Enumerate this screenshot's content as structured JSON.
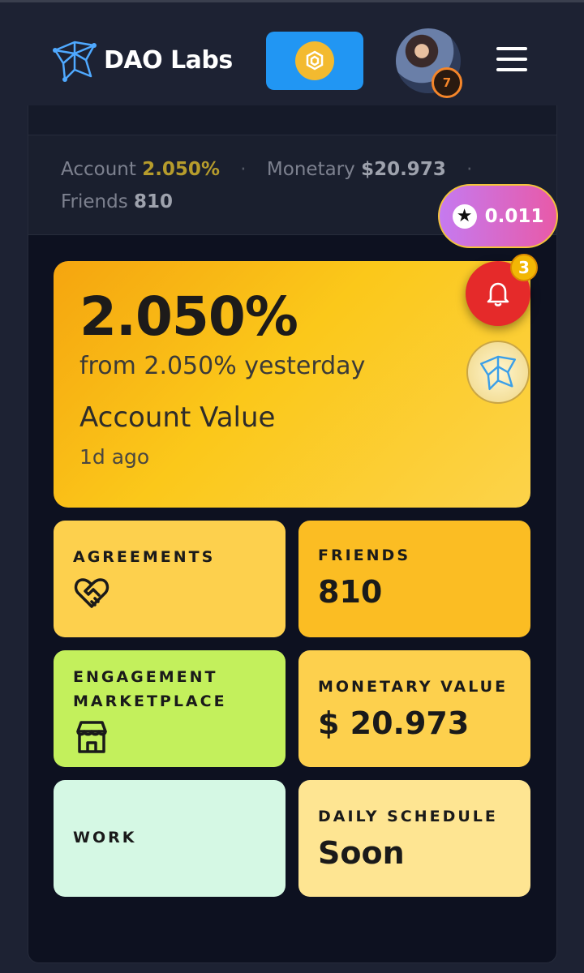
{
  "header": {
    "brand": "DAO Labs",
    "wallet_icon": "bnb-coin-icon",
    "user_level": "7",
    "menu_icon": "hamburger-icon"
  },
  "stats": {
    "account_label": "Account",
    "account_value": "2.050%",
    "monetary_label": "Monetary",
    "monetary_value": "$20.973",
    "friends_label": "Friends",
    "friends_value": "810",
    "separator": "·"
  },
  "floating": {
    "points": "0.011",
    "notification_count": "3"
  },
  "hero": {
    "percent": "2.050%",
    "subtitle": "from 2.050% yesterday",
    "label": "Account Value",
    "time": "1d ago"
  },
  "tiles": {
    "agreements": {
      "title": "AGREEMENTS",
      "icon": "handshake-heart-icon"
    },
    "friends": {
      "title": "FRIENDS",
      "value": "810"
    },
    "marketplace": {
      "title_line1": "ENGAGEMENT",
      "title_line2": "MARKETPLACE",
      "icon": "storefront-icon"
    },
    "monetary": {
      "title": "MONETARY VALUE",
      "value": "$ 20.973"
    },
    "work": {
      "title": "WORK"
    },
    "daily": {
      "title": "DAILY SCHEDULE",
      "value": "Soon"
    }
  },
  "colors": {
    "background": "#1d2233",
    "panel": "#0d1120",
    "wallet_button": "#2196f3",
    "accent_yellow": "#fbc81a",
    "notification_red": "#e52a2a",
    "marketplace_green": "#c3f05c",
    "work_mint": "#d5f8e4"
  }
}
